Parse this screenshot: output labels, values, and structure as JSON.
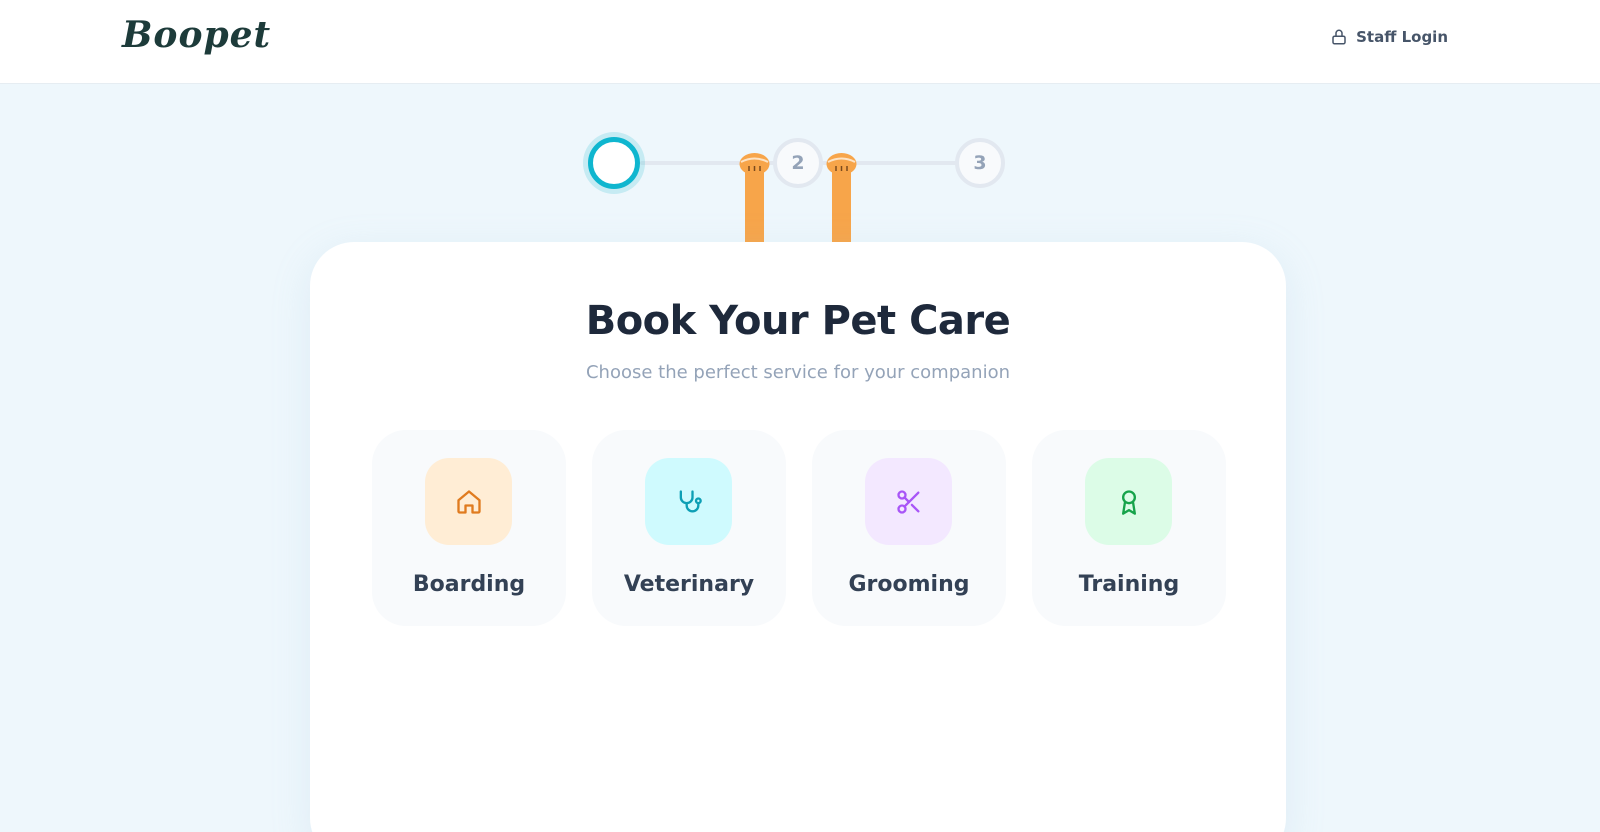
{
  "header": {
    "logo_text": "Boopet",
    "staff_login_label": "Staff Login",
    "staff_login_icon": "lock-icon"
  },
  "stepper": {
    "steps": [
      {
        "label": "",
        "state": "active"
      },
      {
        "label": "2",
        "state": "pending"
      },
      {
        "label": "3",
        "state": "pending"
      }
    ]
  },
  "main": {
    "title": "Book Your Pet Care",
    "subtitle": "Choose the perfect service for your companion",
    "services": [
      {
        "label": "Boarding",
        "icon": "home-icon",
        "icon_color": "#e07b1f",
        "bg_color": "#ffedd5"
      },
      {
        "label": "Veterinary",
        "icon": "stethoscope-icon",
        "icon_color": "#0e9fb5",
        "bg_color": "#cffafe"
      },
      {
        "label": "Grooming",
        "icon": "scissors-icon",
        "icon_color": "#a855f7",
        "bg_color": "#f3e8ff"
      },
      {
        "label": "Training",
        "icon": "award-icon",
        "icon_color": "#16a34a",
        "bg_color": "#dcfce7"
      }
    ]
  },
  "colors": {
    "accent": "#0fb6cf",
    "page_bg": "#eef7fc",
    "pet_legs": "#f7a54a"
  }
}
